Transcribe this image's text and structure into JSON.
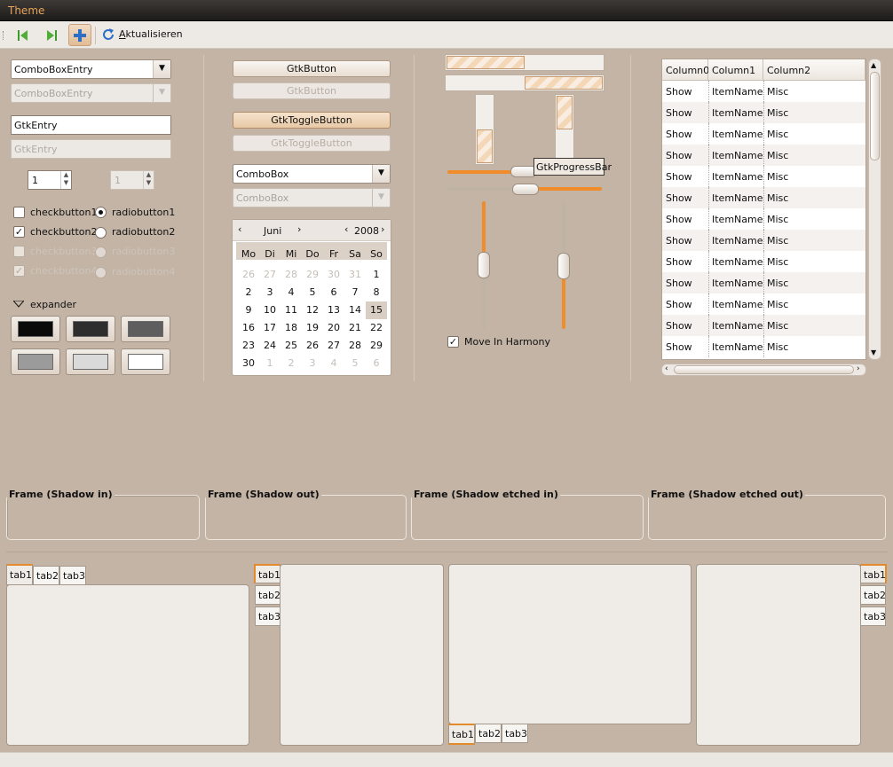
{
  "window": {
    "title": "Theme"
  },
  "toolbar": {
    "refresh_label": "ktualisieren",
    "refresh_accel": "A"
  },
  "left": {
    "combo_entry": "ComboBoxEntry",
    "combo_entry_dis": "ComboBoxEntry",
    "entry": "GtkEntry",
    "entry_dis": "GtkEntry",
    "spin": "1",
    "spin_dis": "1",
    "check1": "checkbutton1",
    "check2": "checkbutton2",
    "check3": "checkbutton3",
    "check4": "checkbutton4",
    "radio1": "radiobutton1",
    "radio2": "radiobutton2",
    "radio3": "radiobutton3",
    "radio4": "radiobutton4",
    "expander": "expander",
    "swatches": [
      "#0a0a0a",
      "#2e2e2e",
      "#5e5e5e",
      "#9b9b9b",
      "#dadada",
      "#ffffff"
    ]
  },
  "middle": {
    "button": "GtkButton",
    "button_dis": "GtkButton",
    "toggle": "GtkToggleButton",
    "toggle_dis": "GtkToggleButton",
    "combo": "ComboBox",
    "combo_dis": "ComboBox"
  },
  "calendar": {
    "month": "Juni",
    "year": "2008",
    "days": [
      "Mo",
      "Di",
      "Mi",
      "Do",
      "Fr",
      "Sa",
      "So"
    ],
    "cells": [
      "26",
      "27",
      "28",
      "29",
      "30",
      "31",
      "1",
      "2",
      "3",
      "4",
      "5",
      "6",
      "7",
      "8",
      "9",
      "10",
      "11",
      "12",
      "13",
      "14",
      "15",
      "16",
      "17",
      "18",
      "19",
      "20",
      "21",
      "22",
      "23",
      "24",
      "25",
      "26",
      "27",
      "28",
      "29",
      "30",
      "1",
      "2",
      "3",
      "4",
      "5",
      "6"
    ],
    "selected": "15"
  },
  "progress": {
    "tooltip": "GtkProgressBar",
    "harmony": "Move In Harmony",
    "h1_fraction": 0.5,
    "v1_fraction": 0.5
  },
  "tree": {
    "columns": [
      "Column0",
      "Column1",
      "Column2"
    ],
    "rows": [
      [
        "Show",
        "ItemName",
        "Misc"
      ],
      [
        "Show",
        "ItemName",
        "Misc"
      ],
      [
        "Show",
        "ItemName",
        "Misc"
      ],
      [
        "Show",
        "ItemName",
        "Misc"
      ],
      [
        "Show",
        "ItemName",
        "Misc"
      ],
      [
        "Show",
        "ItemName",
        "Misc"
      ],
      [
        "Show",
        "ItemName",
        "Misc"
      ],
      [
        "Show",
        "ItemName",
        "Misc"
      ],
      [
        "Show",
        "ItemName",
        "Misc"
      ],
      [
        "Show",
        "ItemName",
        "Misc"
      ],
      [
        "Show",
        "ItemName",
        "Misc"
      ],
      [
        "Show",
        "ItemName",
        "Misc"
      ],
      [
        "Show",
        "ItemName",
        "Misc"
      ]
    ]
  },
  "frames": [
    "Frame (Shadow in)",
    "Frame (Shadow out)",
    "Frame (Shadow etched in)",
    "Frame (Shadow etched out)"
  ],
  "tabs": [
    "tab1",
    "tab2",
    "tab3"
  ],
  "colors": {
    "accent": "#e38a2c",
    "background": "#c3b4a5"
  }
}
